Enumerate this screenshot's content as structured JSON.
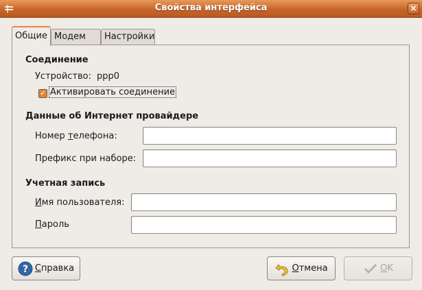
{
  "window": {
    "title": "Свойства интерфейса",
    "close_label": "×"
  },
  "tabs": [
    {
      "label": "Общие"
    },
    {
      "label": "Модем"
    },
    {
      "label": "Настройки"
    }
  ],
  "connection": {
    "title": "Соединение",
    "device_label": "Устройство:",
    "device_value": "ppp0",
    "activate_label": "Активировать соединение",
    "activate_checked": true
  },
  "isp": {
    "title": "Данные об Интернет провайдере",
    "phone_label_pre": "Номер ",
    "phone_label_mnemonic": "т",
    "phone_label_post": "елефона:",
    "phone_value": "",
    "prefix_label": "Префикс при наборе:",
    "prefix_value": ""
  },
  "account": {
    "title": "Учетная запись",
    "username_label_mnemonic": "И",
    "username_label_post": "мя пользователя:",
    "username_value": "",
    "password_label_mnemonic": "П",
    "password_label_post": "ароль",
    "password_value": ""
  },
  "buttons": {
    "help_mnemonic": "С",
    "help_post": "правка",
    "cancel_mnemonic": "О",
    "cancel_post": "тмена",
    "ok_mnemonic": "О",
    "ok_post": "K",
    "ok_enabled": false
  },
  "colors": {
    "titlebar": "#c8652a",
    "accent": "#e8853f",
    "background": "#efebe7"
  }
}
